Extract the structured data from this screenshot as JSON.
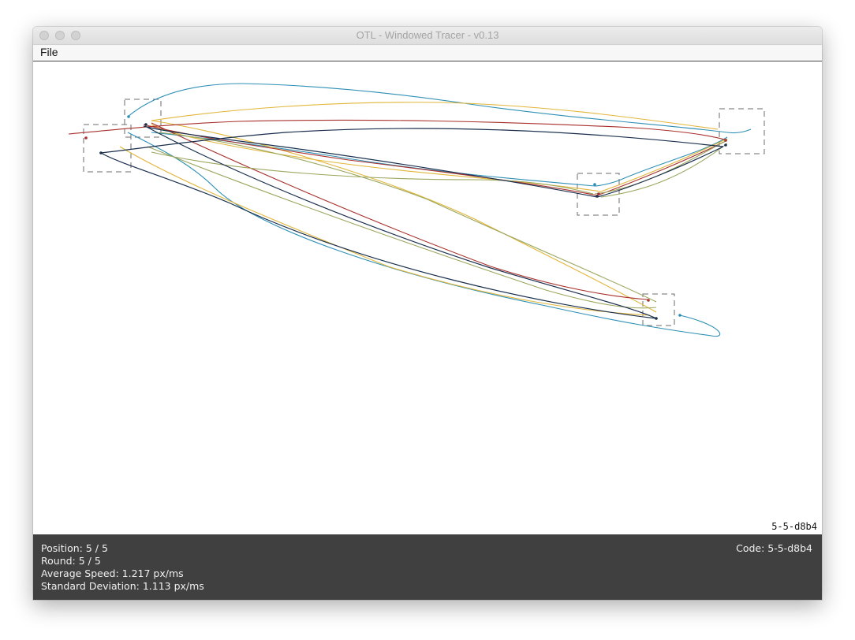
{
  "window": {
    "title": "OTL - Windowed Tracer - v0.13"
  },
  "menu": {
    "file_label": "File"
  },
  "canvas": {
    "code_overlay": "5-5-d8b4"
  },
  "status": {
    "position": "Position: 5 / 5",
    "round": "Round: 5 / 5",
    "average_speed": "Average Speed: 1.217 px/ms",
    "standard_deviation": "Standard Deviation: 1.113 px/ms",
    "code": "Code: 5-5-d8b4"
  },
  "colors": {
    "trace_blue": "#2e8fb5",
    "trace_gold": "#e2b63a",
    "trace_red": "#a8302c",
    "trace_olive": "#9aa65c",
    "trace_navy": "#1a2f4d",
    "status_bar": "#404040",
    "target_box": "#6b6b6b"
  }
}
